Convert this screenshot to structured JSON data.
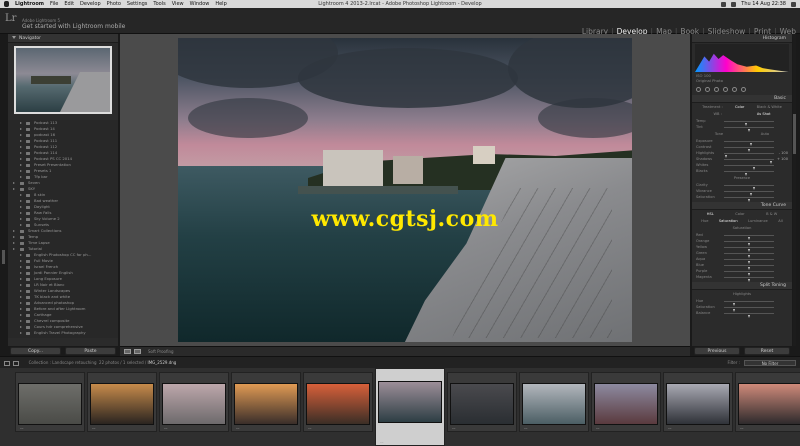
{
  "macbar": {
    "app": "Lightroom",
    "menus": [
      "File",
      "Edit",
      "Develop",
      "Photo",
      "Settings",
      "Tools",
      "View",
      "Window",
      "Help"
    ],
    "window_title": "Lightroom 4 2013-2.lrcat - Adobe Photoshop Lightroom - Develop",
    "clock": "Thu 14 Aug 22:38"
  },
  "identity": {
    "logo": "Lr",
    "line1": "Adobe Lightroom 5",
    "line2": "Get started with Lightroom mobile"
  },
  "modules": [
    "Library",
    "Develop",
    "Map",
    "Book",
    "Slideshow",
    "Print",
    "Web"
  ],
  "active_module": "Develop",
  "left": {
    "navigator": "Navigator",
    "collections": [
      {
        "label": "Podcast 113",
        "count": "",
        "lvl": 1
      },
      {
        "label": "Podcast 14",
        "count": "",
        "lvl": 1
      },
      {
        "label": "podcast 16",
        "count": "",
        "lvl": 1
      },
      {
        "label": "Podcast 111",
        "count": "",
        "lvl": 1
      },
      {
        "label": "Podcast 112",
        "count": "",
        "lvl": 1
      },
      {
        "label": "Podcast 114",
        "count": "",
        "lvl": 1
      },
      {
        "label": "Podcast PS CC 2014",
        "count": "",
        "lvl": 1
      },
      {
        "label": "Preset Presentation",
        "count": "",
        "lvl": 1
      },
      {
        "label": "Presets 1",
        "count": "",
        "lvl": 1
      },
      {
        "label": "Tfp bar",
        "count": "",
        "lvl": 1
      },
      {
        "label": "Seven",
        "count": "",
        "lvl": 0
      },
      {
        "label": "SKY",
        "count": "",
        "lvl": 0
      },
      {
        "label": "8 skin",
        "count": "",
        "lvl": 1
      },
      {
        "label": "Bad weather",
        "count": "",
        "lvl": 1
      },
      {
        "label": "Daylight",
        "count": "",
        "lvl": 1
      },
      {
        "label": "Raw Falls",
        "count": "",
        "lvl": 1
      },
      {
        "label": "Sky Volume 2",
        "count": "",
        "lvl": 1
      },
      {
        "label": "Sunsets",
        "count": "",
        "lvl": 1
      },
      {
        "label": "Smart Collections",
        "count": "",
        "lvl": 0
      },
      {
        "label": "Temp",
        "count": "",
        "lvl": 0
      },
      {
        "label": "Time Lapse",
        "count": "",
        "lvl": 0
      },
      {
        "label": "Tutorial",
        "count": "",
        "lvl": 0
      },
      {
        "label": "English Photoshop CC for ph...",
        "count": "",
        "lvl": 1
      },
      {
        "label": "Full Movie",
        "count": "",
        "lvl": 1
      },
      {
        "label": "Israel French",
        "count": "",
        "lvl": 1
      },
      {
        "label": "Jordi Pannier English",
        "count": "",
        "lvl": 1
      },
      {
        "label": "Long Exposure",
        "count": "",
        "lvl": 1
      },
      {
        "label": "LR Noir et Blanc",
        "count": "",
        "lvl": 1
      },
      {
        "label": "Winter Landscapes",
        "count": "",
        "lvl": 1
      },
      {
        "label": "TK black and white",
        "count": "",
        "lvl": 1
      },
      {
        "label": "Advanced photoshop",
        "count": "",
        "lvl": 1
      },
      {
        "label": "Before and after Lightroom",
        "count": "",
        "lvl": 1
      },
      {
        "label": "Carthage",
        "count": "",
        "lvl": 1
      },
      {
        "label": "Chevrel composite",
        "count": "",
        "lvl": 1
      },
      {
        "label": "Cours hdr comprehensive",
        "count": "",
        "lvl": 1
      },
      {
        "label": "English Travel Photography",
        "count": "",
        "lvl": 1
      }
    ],
    "copy_label": "Copy...",
    "paste_label": "Paste"
  },
  "toolbar": {
    "soft_proofing": "Soft Proofing"
  },
  "watermark": "www.cgtsj.com",
  "right": {
    "histogram": "Histogram",
    "iso": "ISO 100",
    "original_photo": "Original Photo",
    "basic": "Basic",
    "treatment": "Treatment :",
    "color": "Color",
    "bw": "Black & White",
    "wb": "WB :",
    "as_shot": "As Shot",
    "sliders_top": [
      {
        "label": "Temp",
        "value": "",
        "pos": 0.45
      },
      {
        "label": "Tint",
        "value": "",
        "pos": 0.5
      }
    ],
    "tone": "Tone",
    "auto": "Auto",
    "sliders_tone": [
      {
        "label": "Exposure",
        "value": "",
        "pos": 0.55
      },
      {
        "label": "Contrast",
        "value": "",
        "pos": 0.5
      },
      {
        "label": "Highlights",
        "value": "- 100",
        "pos": 0.05
      },
      {
        "label": "Shadows",
        "value": "+ 100",
        "pos": 0.95
      },
      {
        "label": "Whites",
        "value": "",
        "pos": 0.6
      },
      {
        "label": "Blacks",
        "value": "",
        "pos": 0.45
      }
    ],
    "presence": "Presence",
    "sliders_presence": [
      {
        "label": "Clarity",
        "value": "",
        "pos": 0.6
      },
      {
        "label": "Vibrance",
        "value": "",
        "pos": 0.55
      },
      {
        "label": "Saturation",
        "value": "",
        "pos": 0.5
      }
    ],
    "tone_curve": "Tone Curve",
    "hsl_tabs": [
      "HSL",
      "Color",
      "B & W"
    ],
    "hsl_sub": [
      "Hue",
      "Saturation",
      "Luminance",
      "All"
    ],
    "saturation": "Saturation",
    "sliders_hsl": [
      {
        "label": "Red",
        "value": "",
        "pos": 0.5
      },
      {
        "label": "Orange",
        "value": "",
        "pos": 0.5
      },
      {
        "label": "Yellow",
        "value": "",
        "pos": 0.5
      },
      {
        "label": "Green",
        "value": "",
        "pos": 0.5
      },
      {
        "label": "Aqua",
        "value": "",
        "pos": 0.5
      },
      {
        "label": "Blue",
        "value": "",
        "pos": 0.5
      },
      {
        "label": "Purple",
        "value": "",
        "pos": 0.5
      },
      {
        "label": "Magenta",
        "value": "",
        "pos": 0.5
      }
    ],
    "split_toning": "Split Toning",
    "highlights_label": "Highlights",
    "sliders_split": [
      {
        "label": "Hue",
        "value": "",
        "pos": 0.2
      },
      {
        "label": "Saturation",
        "value": "",
        "pos": 0.2
      },
      {
        "label": "Balance",
        "value": "",
        "pos": 0.5
      }
    ],
    "previous": "Previous",
    "reset": "Reset"
  },
  "filmbar": {
    "collection": "Collection : Landscape retouching",
    "count": "22 photos / 1 selected /",
    "file": "IMG_2529.dng",
    "filter": "Filter :",
    "no_filter": "No Filter"
  },
  "filmstrip": [
    {
      "c1": "#6e6e6a",
      "c2": "#4a4b47",
      "sel": false
    },
    {
      "c1": "#c78b4b",
      "c2": "#2a2420",
      "sel": false
    },
    {
      "c1": "#bda7ab",
      "c2": "#6d6a6c",
      "sel": false
    },
    {
      "c1": "#e09a54",
      "c2": "#3a2e2a",
      "sel": false
    },
    {
      "c1": "#d8603a",
      "c2": "#3b2e26",
      "sel": false
    },
    {
      "c1": "#9c8e98",
      "c2": "#2d3e44",
      "sel": true
    },
    {
      "c1": "#4a4a4e",
      "c2": "#2a2e32",
      "sel": false
    },
    {
      "c1": "#b3b7bd",
      "c2": "#4b5e64",
      "sel": false
    },
    {
      "c1": "#8d8aa0",
      "c2": "#5a3a3e",
      "sel": false
    },
    {
      "c1": "#a9a9b3",
      "c2": "#2f3238",
      "sel": false
    },
    {
      "c1": "#cf8a7a",
      "c2": "#2e2a2c",
      "sel": false
    }
  ]
}
